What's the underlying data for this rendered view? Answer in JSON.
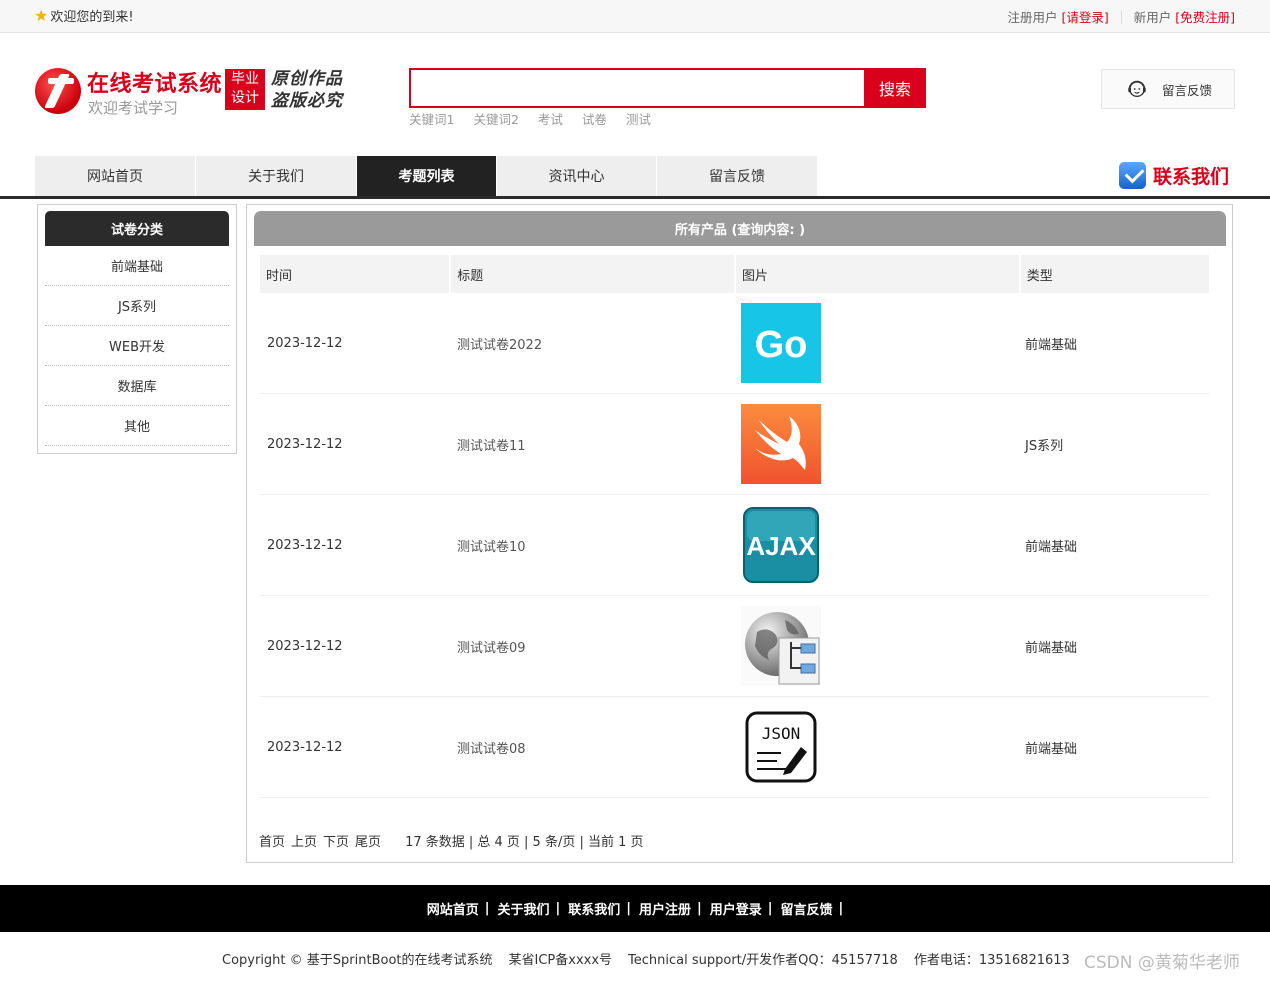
{
  "topbar": {
    "welcome": "欢迎您的到来!",
    "register_label": "注册用户",
    "login_link": "[请登录]",
    "new_user_label": "新用户",
    "signup_link": "[免费注册]"
  },
  "header": {
    "site_title": "在线考试系统",
    "site_subtitle": "欢迎考试学习",
    "badge_line1": "毕业",
    "badge_line2": "设计",
    "slogan_line1": "原创作品",
    "slogan_line2": "盗版必究",
    "search_placeholder": "",
    "search_button": "搜索",
    "hotwords": [
      "关键词1",
      "关键词2",
      "考试",
      "试卷",
      "测试"
    ],
    "feedback_label": "留言反馈"
  },
  "nav": {
    "items": [
      "网站首页",
      "关于我们",
      "考题列表",
      "资讯中心",
      "留言反馈"
    ],
    "active_index": 2,
    "contact_label": "联系我们"
  },
  "sidebar": {
    "title": "试卷分类",
    "items": [
      "前端基础",
      "JS系列",
      "WEB开发",
      "数据库",
      "其他"
    ]
  },
  "main": {
    "title": "所有产品 (查询内容: )",
    "columns": [
      "时间",
      "标题",
      "图片",
      "类型"
    ],
    "rows": [
      {
        "time": "2023-12-12",
        "title": "测试试卷2022",
        "image": "go-logo-icon",
        "type": "前端基础"
      },
      {
        "time": "2023-12-12",
        "title": "测试试卷11",
        "image": "swift-logo-icon",
        "type": "JS系列"
      },
      {
        "time": "2023-12-12",
        "title": "测试试卷10",
        "image": "ajax-logo-icon",
        "type": "前端基础"
      },
      {
        "time": "2023-12-12",
        "title": "测试试卷09",
        "image": "globe-sitemap-icon",
        "type": "前端基础"
      },
      {
        "time": "2023-12-12",
        "title": "测试试卷08",
        "image": "json-edit-icon",
        "type": "前端基础"
      }
    ],
    "pager": {
      "first": "首页",
      "prev": "上页",
      "next": "下页",
      "last": "尾页",
      "summary": "17 条数据 | 总 4 页 | 5 条/页 | 当前 1 页"
    }
  },
  "footer": {
    "links": [
      "网站首页",
      "关于我们",
      "联系我们",
      "用户注册",
      "用户登录",
      "留言反馈"
    ],
    "copyright": "Copyright © 基于SprintBoot的在线考试系统",
    "icp": "某省ICP备xxxx号",
    "support": "Technical support/开发作者QQ：45157718",
    "phone": "作者电话：13516821613",
    "watermark": "CSDN @黄菊华老师"
  },
  "colors": {
    "accent": "#d9001b",
    "nav_active": "#222222",
    "footer_bg": "#000000"
  }
}
